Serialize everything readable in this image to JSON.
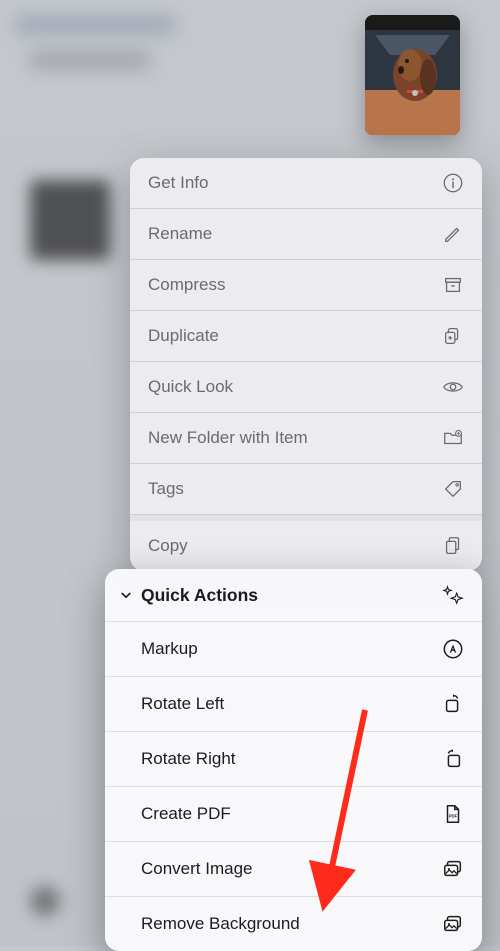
{
  "menu": {
    "items": [
      {
        "label": "Get Info",
        "icon": "info-icon"
      },
      {
        "label": "Rename",
        "icon": "pencil-icon"
      },
      {
        "label": "Compress",
        "icon": "archive-icon"
      },
      {
        "label": "Duplicate",
        "icon": "duplicate-icon"
      },
      {
        "label": "Quick Look",
        "icon": "eye-icon"
      },
      {
        "label": "New Folder with Item",
        "icon": "new-folder-icon"
      },
      {
        "label": "Tags",
        "icon": "tag-icon"
      },
      {
        "label": "Copy",
        "icon": "copy-icon"
      }
    ]
  },
  "quick_actions": {
    "title": "Quick Actions",
    "items": [
      {
        "label": "Markup",
        "icon": "markup-icon"
      },
      {
        "label": "Rotate Left",
        "icon": "rotate-left-icon"
      },
      {
        "label": "Rotate Right",
        "icon": "rotate-right-icon"
      },
      {
        "label": "Create PDF",
        "icon": "pdf-icon"
      },
      {
        "label": "Convert Image",
        "icon": "convert-image-icon"
      },
      {
        "label": "Remove Background",
        "icon": "remove-bg-icon"
      }
    ]
  },
  "annotation": {
    "target": "remove-background-action",
    "color": "#ff0000"
  }
}
